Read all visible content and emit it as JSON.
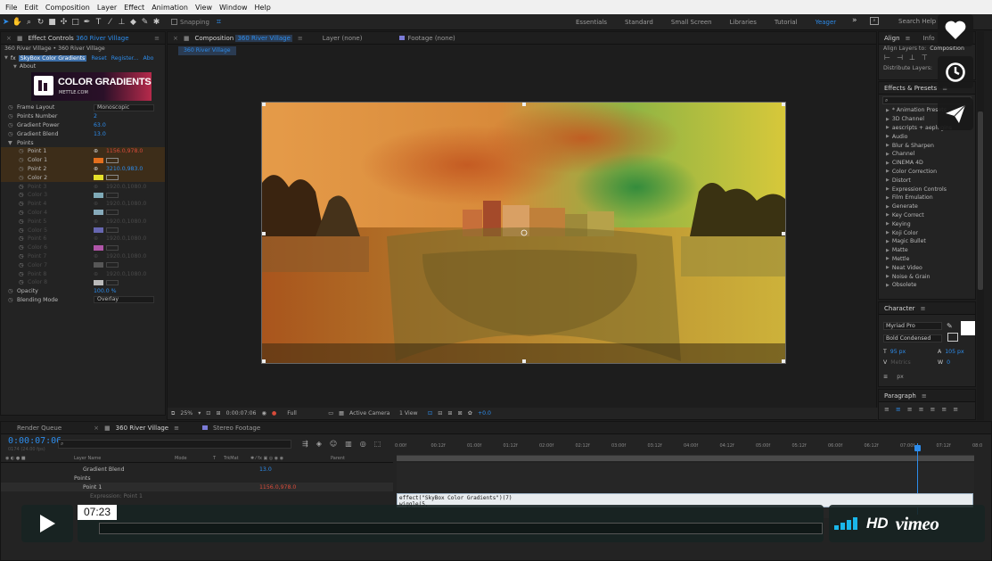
{
  "menu": [
    "File",
    "Edit",
    "Composition",
    "Layer",
    "Effect",
    "Animation",
    "View",
    "Window",
    "Help"
  ],
  "toolbar": {
    "snapping": "Snapping",
    "workspaces": [
      "Essentials",
      "Standard",
      "Small Screen",
      "Libraries",
      "Tutorial",
      "Yeager"
    ],
    "active_workspace": "Yeager",
    "search_help": "Search Help"
  },
  "effect_controls": {
    "tab": "Effect Controls",
    "tab_layer": "360 River Village",
    "breadcrumb": "360 River Village • 360 River Village",
    "effect_name": "SkyBox Color Gradients",
    "reset": "Reset",
    "register": "Register...",
    "about_short": "Abo",
    "about": "About",
    "logo_title": "COLOR GRADIENTS",
    "logo_sub": "METTLE.COM",
    "props": [
      {
        "label": "Frame Layout",
        "kind": "dropdown",
        "value": "Monoscopic"
      },
      {
        "label": "Points Number",
        "kind": "value",
        "value": "2"
      },
      {
        "label": "Gradient Power",
        "kind": "value",
        "value": "63.0"
      },
      {
        "label": "Gradient Blend",
        "kind": "value",
        "value": "13.0"
      },
      {
        "label": "Points",
        "kind": "group"
      },
      {
        "label": "Point 1",
        "kind": "point",
        "value": "1156.0,978.0",
        "red": true
      },
      {
        "label": "Color 1",
        "kind": "color",
        "color": "#e36f1e"
      },
      {
        "label": "Point 2",
        "kind": "point",
        "value": "3210.0,983.0"
      },
      {
        "label": "Color 2",
        "kind": "color",
        "color": "#e6e02a"
      },
      {
        "label": "Point 3",
        "kind": "dimpoint",
        "value": "1920.0,1080.0"
      },
      {
        "label": "Color 3",
        "kind": "dimcolor",
        "color": "#9fd8ea"
      },
      {
        "label": "Point 4",
        "kind": "dimpoint",
        "value": "1920.0,1080.0"
      },
      {
        "label": "Color 4",
        "kind": "dimcolor",
        "color": "#a8d8ee"
      },
      {
        "label": "Point 5",
        "kind": "dimpoint",
        "value": "1920.0,1080.0"
      },
      {
        "label": "Color 5",
        "kind": "dimcolor",
        "color": "#7d7ee0"
      },
      {
        "label": "Point 6",
        "kind": "dimpoint",
        "value": "1920.0,1080.0"
      },
      {
        "label": "Color 6",
        "kind": "dimcolor",
        "color": "#e067d6"
      },
      {
        "label": "Point 7",
        "kind": "dimpoint",
        "value": "1920.0,1080.0"
      },
      {
        "label": "Color 7",
        "kind": "dimcolor",
        "color": "#6a6a6a"
      },
      {
        "label": "Point 8",
        "kind": "dimpoint",
        "value": "1920.0,1080.0"
      },
      {
        "label": "Color 8",
        "kind": "dimcolor",
        "color": "#eeeeee"
      },
      {
        "label": "Opacity",
        "kind": "value",
        "value": "100.0 %"
      },
      {
        "label": "Blending Mode",
        "kind": "dropdown",
        "value": "Overlay"
      }
    ]
  },
  "composition": {
    "tab": "Composition",
    "tab_name": "360 River Village",
    "layer_tab": "Layer (none)",
    "footage_tab": "Footage (none)",
    "sub_tab": "360 River Village",
    "zoom": "25%",
    "timecode": "0:00:07:06",
    "resolution": "Full",
    "camera": "Active Camera",
    "view": "1 View",
    "exposure": "+0.0"
  },
  "align": {
    "tab": "Align",
    "info_tab": "Info",
    "align_to_label": "Align Layers to:",
    "align_to_value": "Composition",
    "distribute": "Distribute Layers:"
  },
  "effects_presets": {
    "tab": "Effects & Presets",
    "items": [
      "* Animation Presets",
      "3D Channel",
      "aescripts + aeplugins",
      "Audio",
      "Blur & Sharpen",
      "Channel",
      "CINEMA 4D",
      "Color Correction",
      "Distort",
      "Expression Controls",
      "Film Emulation",
      "Generate",
      "Key Correct",
      "Keying",
      "Koji Color",
      "Magic Bullet",
      "Matte",
      "Mettle",
      "Neat Video",
      "Noise & Grain",
      "Obsolete"
    ]
  },
  "character": {
    "tab": "Character",
    "font": "Myriad Pro",
    "style": "Bold Condensed",
    "size": "95 px",
    "leading": "105 px",
    "tracking": "Metrics",
    "kerning": "0",
    "unit": "px"
  },
  "paragraph": {
    "tab": "Paragraph"
  },
  "timeline": {
    "render_queue": "Render Queue",
    "comp_tab": "360 River Village",
    "stereo_tab": "Stereo Footage",
    "timecode": "0:00:07:06",
    "frame_sub": "0174 (24.00 fps)",
    "col_layer_name": "Layer Name",
    "col_mode": "Mode",
    "col_t": "T",
    "col_trkmat": "TrkMat",
    "col_parent": "Parent",
    "ruler": [
      "0:00f",
      "00:12f",
      "01:00f",
      "01:12f",
      "02:00f",
      "02:12f",
      "03:00f",
      "03:12f",
      "04:00f",
      "04:12f",
      "05:00f",
      "05:12f",
      "06:00f",
      "06:12f",
      "07:00f",
      "07:12f",
      "08:0"
    ],
    "layers": [
      {
        "label": "Gradient Blend",
        "value": "13.0"
      },
      {
        "label": "Points",
        "value": ""
      },
      {
        "label": "Point 1",
        "value": "1156.0,978.0"
      },
      {
        "label": "Expression: Point 1",
        "value": ""
      }
    ],
    "expression_line1": "effect(\"SkyBox Color Gradients\")(7)",
    "expression_line2": "wiggle(5,"
  },
  "video": {
    "time": "07:23",
    "hd": "HD",
    "brand": "vimeo"
  },
  "colors": {
    "accent_blue": "#2d8ceb",
    "panel_bg": "#232323",
    "selected_orange": "#e36f1e"
  }
}
